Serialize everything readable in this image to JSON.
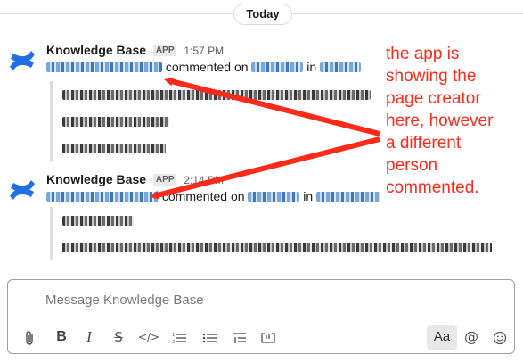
{
  "day_divider": {
    "label": "Today"
  },
  "messages": [
    {
      "sender": "Knowledge Base",
      "badge": "APP",
      "time": "1:57 PM",
      "verb": "commented",
      "on_word": "on",
      "in_word": "in"
    },
    {
      "sender": "Knowledge Base",
      "badge": "APP",
      "time": "2:14 PM",
      "verb": "commented",
      "on_word": "on",
      "in_word": "in"
    }
  ],
  "annotation": {
    "text_lines": [
      "the app is",
      "showing the",
      "page creator",
      "here, however",
      "a different",
      "person",
      "commented."
    ],
    "color": "#ff2a1a"
  },
  "composer": {
    "placeholder": "Message Knowledge Base",
    "value": "",
    "toolbar": {
      "attach_icon": "paperclip-icon",
      "bold_label": "B",
      "italic_label": "I",
      "strike_label": "S",
      "code_label": "</>",
      "aa_label": "Aa",
      "mention_label": "@"
    }
  },
  "colors": {
    "brand_blue": "#1f6fe5",
    "divider": "#dddddd",
    "link_blue": "#1264a3"
  }
}
